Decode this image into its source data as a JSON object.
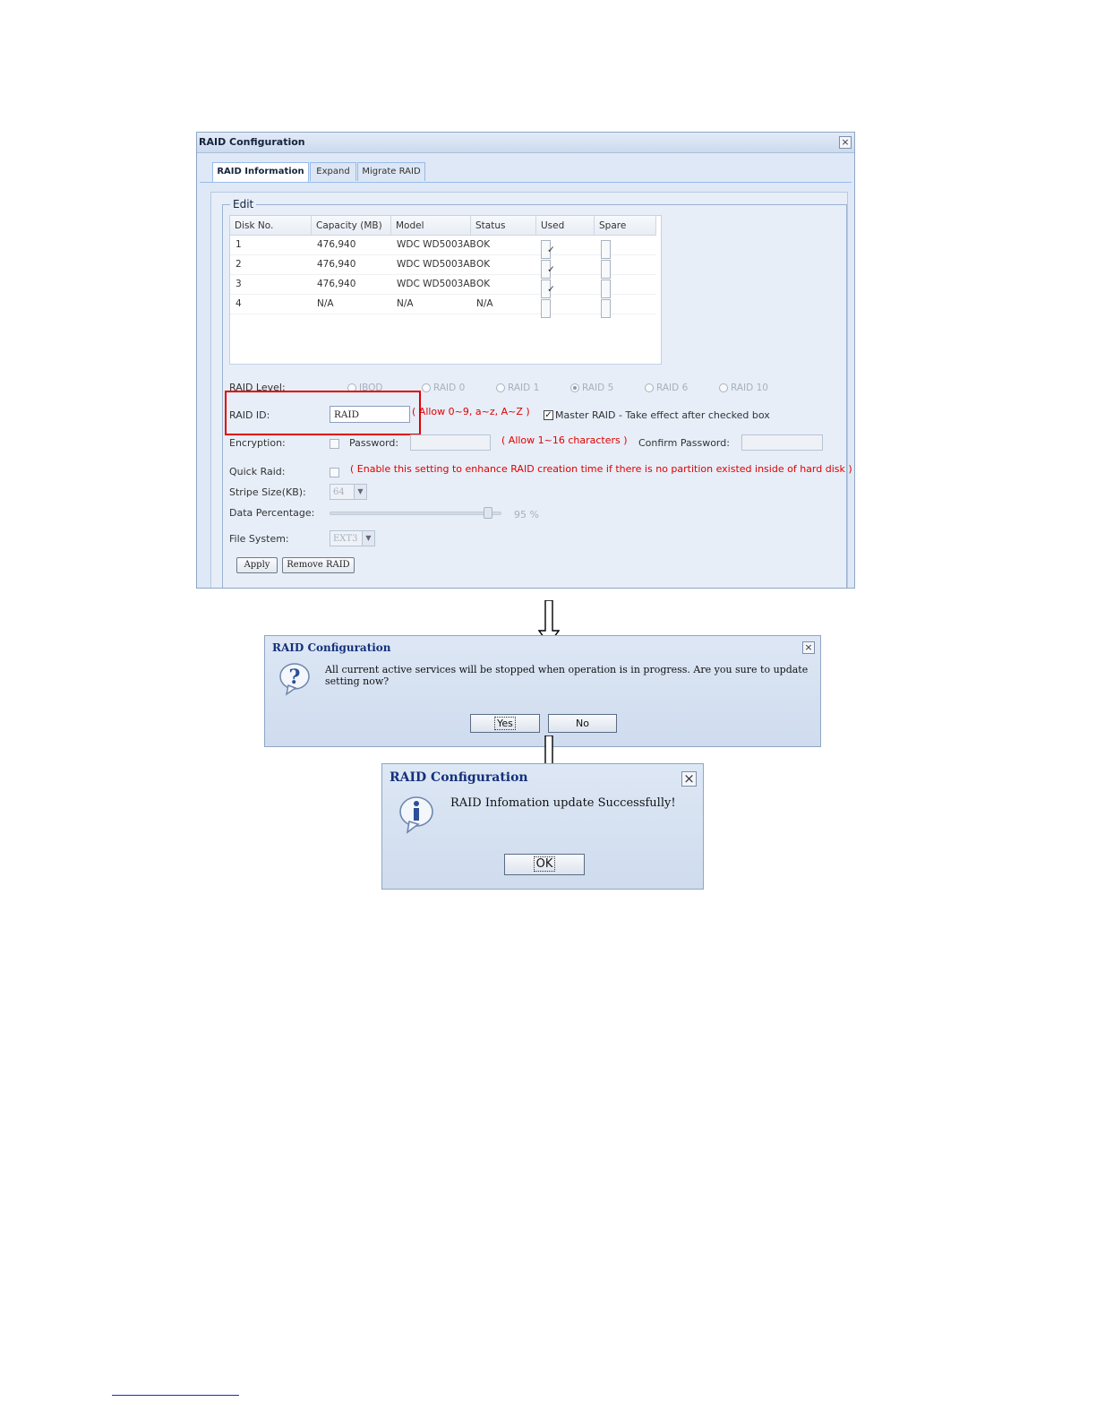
{
  "main_window": {
    "title": "RAID Configuration",
    "close_glyph": "×",
    "tabs": [
      "RAID Information",
      "Expand",
      "Migrate RAID"
    ],
    "legend": "Edit",
    "table": {
      "columns": [
        "Disk No.",
        "Capacity (MB)",
        "Model",
        "Status",
        "Used",
        "Spare"
      ],
      "rows": [
        {
          "disk": "1",
          "capacity": "476,940",
          "model": "WDC WD5003AB",
          "status": "OK",
          "used": true,
          "spare": false
        },
        {
          "disk": "2",
          "capacity": "476,940",
          "model": "WDC WD5003AB",
          "status": "OK",
          "used": true,
          "spare": false
        },
        {
          "disk": "3",
          "capacity": "476,940",
          "model": "WDC WD5003AB",
          "status": "OK",
          "used": true,
          "spare": false
        },
        {
          "disk": "4",
          "capacity": "N/A",
          "model": "N/A",
          "status": "N/A",
          "used": false,
          "spare": false
        }
      ]
    },
    "raid_level": {
      "label": "RAID Level:",
      "options": [
        "JBOD",
        "RAID 0",
        "RAID 1",
        "RAID 5",
        "RAID 6",
        "RAID 10"
      ],
      "selected": "RAID 5"
    },
    "raid_id": {
      "label": "RAID ID:",
      "value": "RAID",
      "hint": "( Allow 0~9, a~z, A~Z )"
    },
    "master_raid": {
      "label": "Master RAID - Take effect after checked box",
      "checked": true
    },
    "encryption": {
      "label": "Encryption:",
      "password_label": "Password:",
      "hint": "( Allow 1~16 characters )",
      "confirm_label": "Confirm Password:"
    },
    "quick_raid": {
      "label": "Quick Raid:",
      "hint": "( Enable this setting to enhance RAID creation time if there is no partition existed inside of hard disk )"
    },
    "stripe_size": {
      "label": "Stripe Size(KB):",
      "value": "64"
    },
    "data_percentage": {
      "label": "Data Percentage:",
      "value": "95 %",
      "fraction": 0.95
    },
    "file_system": {
      "label": "File System:",
      "value": "EXT3"
    },
    "buttons": {
      "apply": "Apply",
      "remove": "Remove RAID"
    }
  },
  "confirm_dialog": {
    "title": "RAID Configuration",
    "message": "All current active services will be stopped when operation is in progress. Are you sure to update setting now?",
    "icon": "question-icon",
    "yes": "Yes",
    "no": "No"
  },
  "success_dialog": {
    "title": "RAID Configuration",
    "message": "RAID Infomation update Successfully!",
    "icon": "info-icon",
    "ok": "OK"
  },
  "colors": {
    "hint_red": "#e00000",
    "dialog_title": "#15307a",
    "window_bg": "#dfe8f6"
  }
}
